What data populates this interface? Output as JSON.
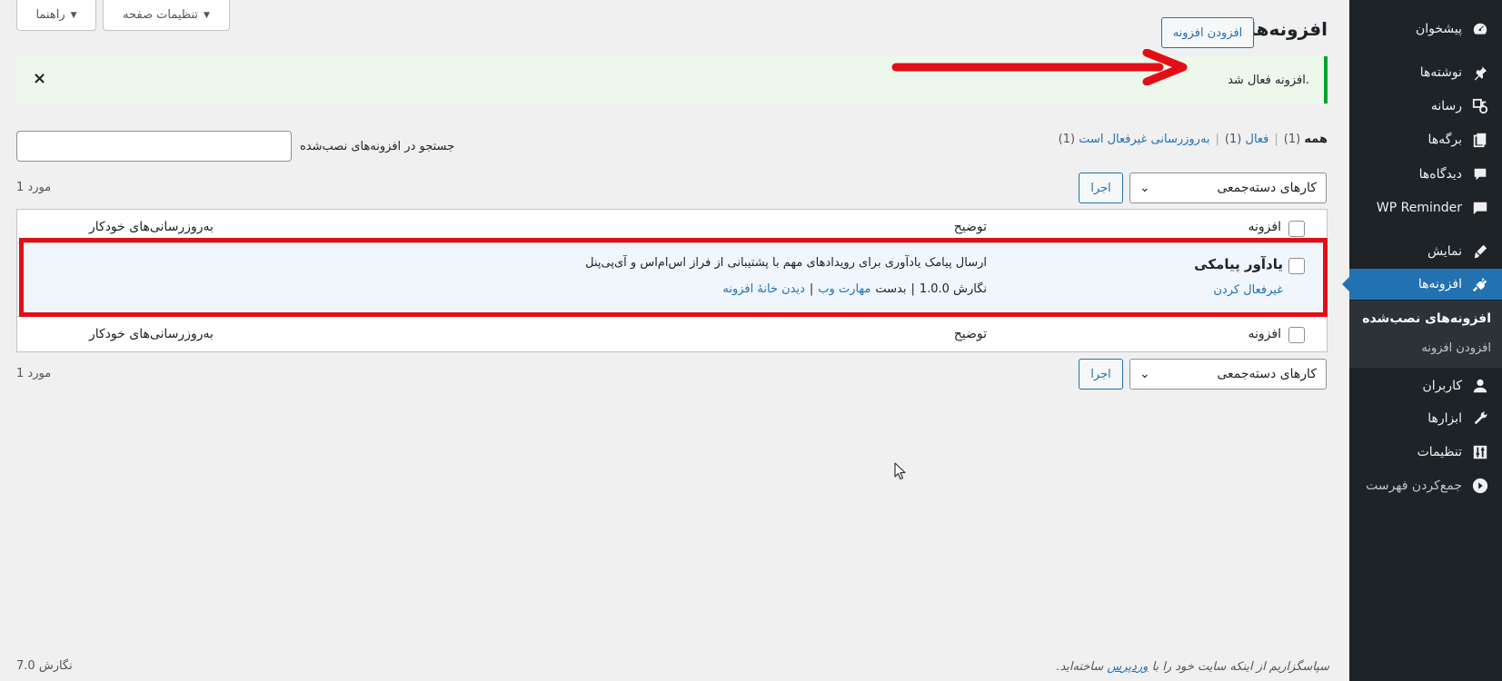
{
  "screen_meta": {
    "help": "راهنما",
    "screen_options": "تنظیمات صفحه"
  },
  "header": {
    "title": "افزونه‌ها",
    "add_new": "افزودن افزونه"
  },
  "notice": {
    "message": "افزونه فعال شد.",
    "dismiss": "×"
  },
  "filters": {
    "all": "همه",
    "all_count": "(1)",
    "active": "فعال",
    "active_count": "(1)",
    "auto_updates_disabled": "به‌روزرسانی غیرفعال است",
    "auto_updates_count": "(1)",
    "sep": "|"
  },
  "search": {
    "label": "جستجو در افزونه‌های نصب‌شده",
    "value": ""
  },
  "bulk": {
    "label": "کارهای دسته‌جمعی",
    "apply": "اجرا",
    "count": "1 مورد"
  },
  "table": {
    "col_plugin": "افزونه",
    "col_description": "توضیح",
    "col_auto_updates": "به‌روزرسانی‌های خودکار",
    "plugin": {
      "name": "یادآور پیامکی",
      "deactivate": "غیرفعال کردن",
      "description": "ارسال پیامک یادآوری برای رویدادهای مهم با پشتیبانی از فراز اس‌ام‌اس و آی‌پی‌پنل",
      "version_text": "نگارش 1.0.0",
      "by": "بدست",
      "author": "مهارت وب",
      "view_site": "دیدن خانهٔ افزونه",
      "sep": "|"
    }
  },
  "sidebar": {
    "items": [
      {
        "label": "پیشخوان",
        "icon": "dashboard-icon"
      },
      {
        "label": "نوشته‌ها",
        "icon": "pin-icon"
      },
      {
        "label": "رسانه",
        "icon": "media-icon"
      },
      {
        "label": "برگه‌ها",
        "icon": "pages-icon"
      },
      {
        "label": "دیدگاه‌ها",
        "icon": "comments-icon"
      },
      {
        "label": "WP Reminder",
        "icon": "reminder-icon"
      },
      {
        "label": "نمایش",
        "icon": "appearance-icon"
      },
      {
        "label": "افزونه‌ها",
        "icon": "plugins-icon"
      },
      {
        "label": "کاربران",
        "icon": "users-icon"
      },
      {
        "label": "ابزارها",
        "icon": "tools-icon"
      },
      {
        "label": "تنظیمات",
        "icon": "settings-icon"
      },
      {
        "label": "جمع‌کردن فهرست",
        "icon": "collapse-icon"
      }
    ],
    "submenu": [
      "افزونه‌های نصب‌شده",
      "افزودن افزونه"
    ]
  },
  "footer": {
    "thanks_prefix": "سپاسگزاریم از اینکه سایت خود را با",
    "wordpress": "وردپرس",
    "thanks_suffix": "ساخته‌اید.",
    "version": "نگارش 7.0"
  },
  "colors": {
    "accent": "#2271b1",
    "sidebar": "#1d2327",
    "notice_border": "#00a32a",
    "highlight": "#e10e17"
  }
}
